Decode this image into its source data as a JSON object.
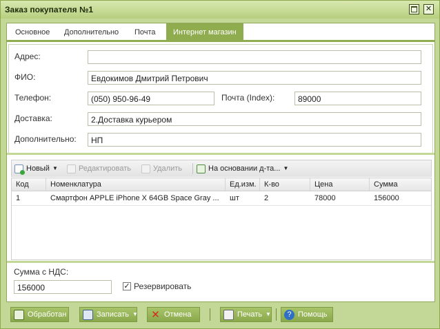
{
  "window": {
    "title": "Заказ покупателя №1"
  },
  "tabs": [
    {
      "label": "Основное",
      "active": false
    },
    {
      "label": "Дополнительно",
      "active": false
    },
    {
      "label": "Почта",
      "active": false
    },
    {
      "label": "Интернет магазин",
      "active": true
    }
  ],
  "form": {
    "address_label": "Адрес:",
    "address_value": "",
    "fio_label": "ФИО:",
    "fio_value": "Евдокимов Дмитрий Петрович",
    "phone_label": "Телефон:",
    "phone_value": "(050) 950-96-49",
    "post_label": "Почта (Index):",
    "post_value": "89000",
    "delivery_label": "Доставка:",
    "delivery_value": "2.Доставка курьером",
    "extra_label": "Дополнительно:",
    "extra_value": "НП"
  },
  "toolbar": {
    "new_label": "Новый",
    "edit_label": "Редактировать",
    "delete_label": "Удалить",
    "based_on_label": "На основании д-та..."
  },
  "table": {
    "columns": [
      "Код",
      "Номенклатура",
      "Ед.изм.",
      "К-во",
      "Цена",
      "Сумма"
    ],
    "rows": [
      [
        "1",
        "Смартфон APPLE iPhone X 64GB Space Gray ...",
        "шт",
        "2",
        "78000",
        "156000"
      ]
    ]
  },
  "summary": {
    "vat_sum_label": "Сумма с НДС:",
    "vat_sum_value": "156000",
    "reserve_label": "Резервировать",
    "reserve_checked": true
  },
  "footer": {
    "processed_label": "Обработан",
    "save_label": "Записать",
    "cancel_label": "Отмена",
    "print_label": "Печать",
    "help_label": "Помощь"
  },
  "colors": {
    "accent": "#8fac4f",
    "window_bg": "#c3d796"
  }
}
